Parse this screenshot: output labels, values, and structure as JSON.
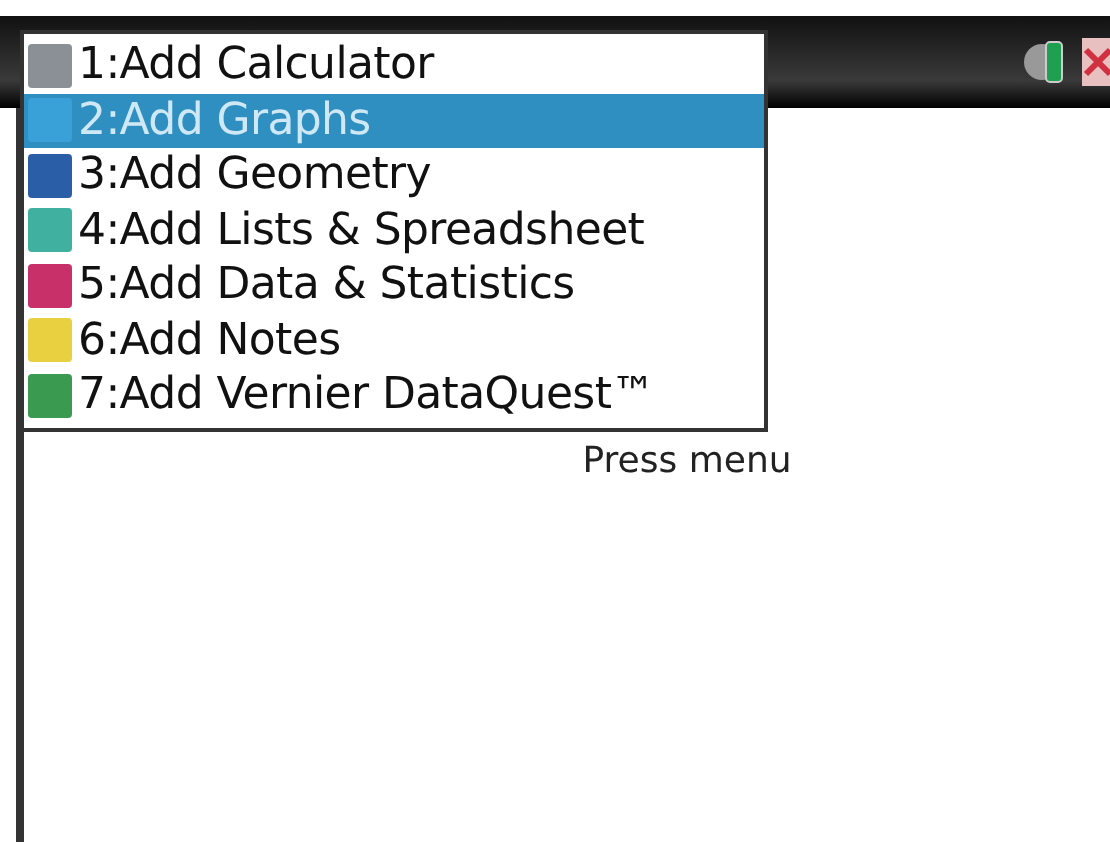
{
  "menu": {
    "items": [
      {
        "label": "1:Add Calculator",
        "selected": false,
        "color": "#8a9096"
      },
      {
        "label": "2:Add Graphs",
        "selected": true,
        "color": "#3aa0d8"
      },
      {
        "label": "3:Add Geometry",
        "selected": false,
        "color": "#2a5fa8"
      },
      {
        "label": "4:Add Lists & Spreadsheet",
        "selected": false,
        "color": "#40b0a0"
      },
      {
        "label": "5:Add Data & Statistics",
        "selected": false,
        "color": "#c8306a"
      },
      {
        "label": "6:Add Notes",
        "selected": false,
        "color": "#e8d040"
      },
      {
        "label": "7:Add Vernier DataQuest™",
        "selected": false,
        "color": "#3a9a50"
      }
    ]
  },
  "hint": "Press menu"
}
